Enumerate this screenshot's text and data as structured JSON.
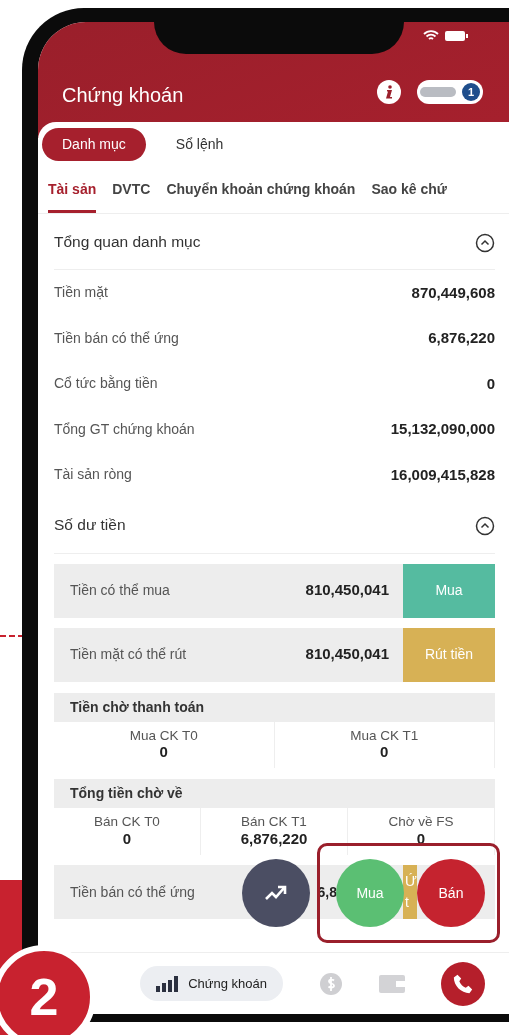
{
  "step_badge": "2",
  "header": {
    "title": "Chứng khoán",
    "notification_count": "1"
  },
  "segments": [
    {
      "label": "Danh mục",
      "selected": true
    },
    {
      "label": "Sổ lệnh",
      "selected": false
    }
  ],
  "tabs": [
    {
      "label": "Tài sản",
      "selected": true
    },
    {
      "label": "DVTC",
      "selected": false
    },
    {
      "label": "Chuyển khoản chứng khoán",
      "selected": false
    },
    {
      "label": "Sao kê chứ",
      "selected": false
    }
  ],
  "overview": {
    "title": "Tổng quan danh mục",
    "expanded": true,
    "rows": [
      {
        "label": "Tiền mặt",
        "value": "870,449,608"
      },
      {
        "label": "Tiền bán có thể ứng",
        "value": "6,876,220"
      },
      {
        "label": "Cổ tức bằng tiền",
        "value": "0"
      },
      {
        "label": "Tổng GT chứng khoán",
        "value": "15,132,090,000"
      },
      {
        "label": "Tài sản ròng",
        "value": "16,009,415,828"
      }
    ]
  },
  "balance": {
    "title": "Số dư tiền",
    "expanded": true,
    "actions": [
      {
        "label": "Tiền có thể mua",
        "value": "810,450,041",
        "button": "Mua",
        "color": "#55bba0"
      },
      {
        "label": "Tiền mặt có thể rút",
        "value": "810,450,041",
        "button": "Rút tiền",
        "color": "#d7b155"
      }
    ],
    "groups": [
      {
        "title": "Tiền chờ thanh toán",
        "cells": [
          {
            "label": "Mua CK T0",
            "value": "0"
          },
          {
            "label": "Mua CK T1",
            "value": "0"
          }
        ]
      },
      {
        "title": "Tổng tiền chờ về",
        "cells": [
          {
            "label": "Bán CK T0",
            "value": "0"
          },
          {
            "label": "Bán CK T1",
            "value": "6,876,220"
          },
          {
            "label": "Chờ về FS",
            "value": "0"
          }
        ]
      }
    ],
    "advance_row": {
      "label": "Tiền bán có thể ứng",
      "value": "6,8",
      "button": "Ứ\nt",
      "color": "#d7b155"
    }
  },
  "floating_buttons": [
    {
      "kind": "chart",
      "color": "#4b4e63"
    },
    {
      "kind": "text",
      "label": "Mua",
      "color": "#5bbf73"
    },
    {
      "kind": "text",
      "label": "Bán",
      "color": "#c5232f"
    }
  ],
  "bottom_nav": [
    {
      "kind": "stocks",
      "label": "Chứng khoán",
      "selected": true
    },
    {
      "kind": "coin",
      "selected": false
    },
    {
      "kind": "wallet",
      "selected": false
    },
    {
      "kind": "phone",
      "selected": false
    }
  ]
}
